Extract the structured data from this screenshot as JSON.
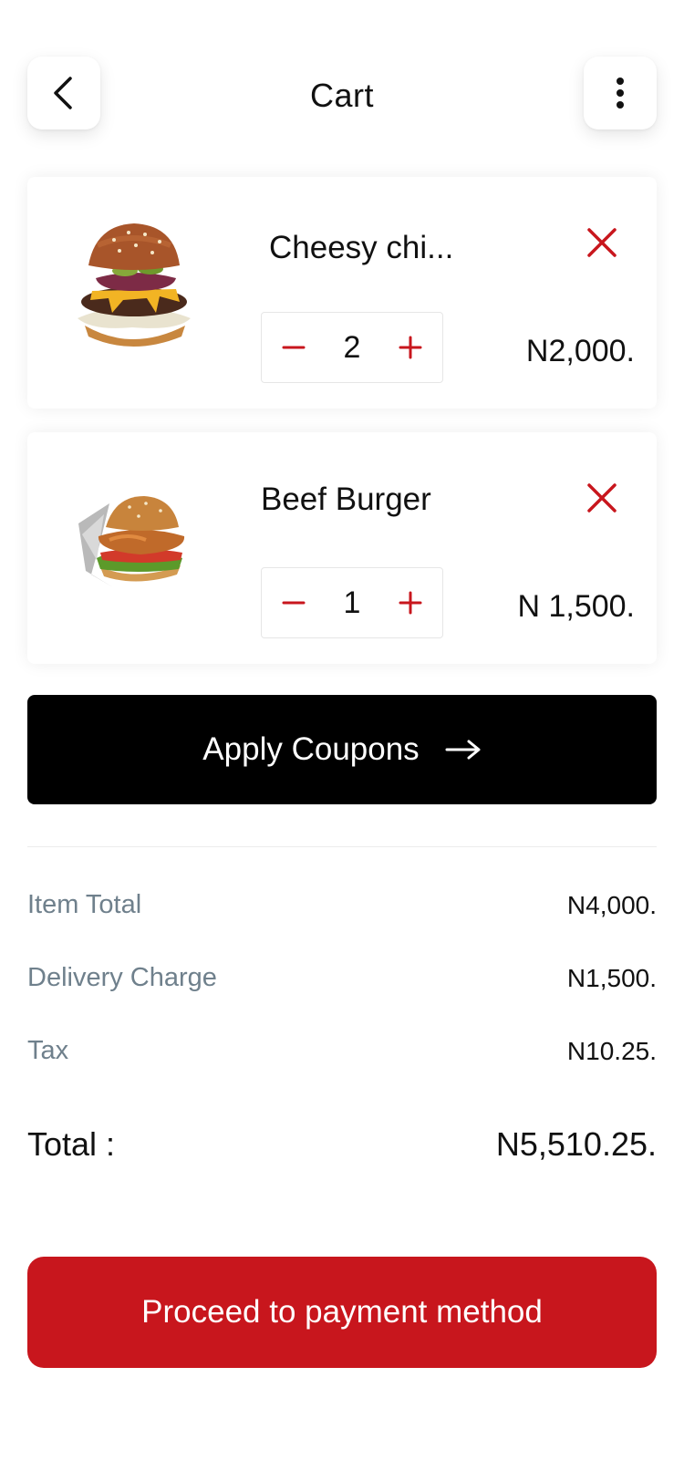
{
  "header": {
    "title": "Cart",
    "back_icon": "chevron-left-icon",
    "more_icon": "more-vertical-icon"
  },
  "cart": {
    "items": [
      {
        "name": "Cheesy chi...",
        "quantity": "2",
        "price": "N2,000.",
        "image": "cheeseburger-image"
      },
      {
        "name": "Beef Burger",
        "quantity": "1",
        "price": "N 1,500.",
        "image": "chicken-burger-image"
      }
    ]
  },
  "coupon": {
    "label": "Apply Coupons",
    "icon": "arrow-right-icon"
  },
  "summary": {
    "item_total_label": "Item Total",
    "item_total_value": "N4,000.",
    "delivery_label": "Delivery Charge",
    "delivery_value": "N1,500.",
    "tax_label": "Tax",
    "tax_value": "N10.25."
  },
  "total": {
    "label": "Total :",
    "value": "N5,510.25."
  },
  "payment_button": {
    "label": "Proceed to payment method"
  },
  "colors": {
    "accent": "#c8161d",
    "coupon_bg": "#000000",
    "label_gray": "#6f808c"
  }
}
